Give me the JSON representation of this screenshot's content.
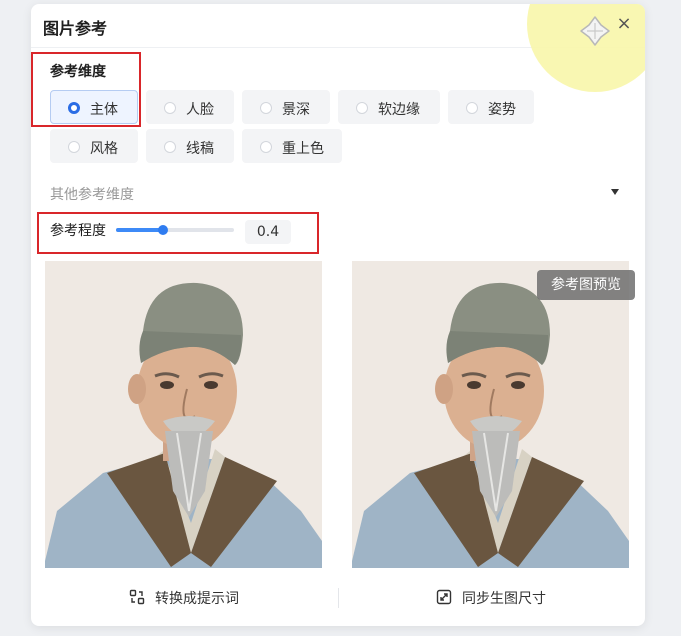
{
  "panel": {
    "title": "图片参考",
    "move_icon": "move-icon",
    "close_label": "×"
  },
  "dimension": {
    "label": "参考维度",
    "selected": "主体",
    "options": [
      "主体",
      "人脸",
      "景深",
      "软边缘",
      "姿势",
      "风格",
      "线稿",
      "重上色"
    ]
  },
  "other_dimensions": {
    "label": "其他参考维度"
  },
  "strength": {
    "label": "参考程度",
    "value": "0.4",
    "level": 0.4
  },
  "images": {
    "preview_badge": "参考图预览"
  },
  "footer": {
    "convert_label": "转换成提示词",
    "convert_icon": "convert-icon",
    "sync_label": "同步生图尺寸",
    "sync_icon": "expand-icon"
  },
  "colors": {
    "accent": "#2b6de5",
    "highlight_box": "#d9262a"
  }
}
